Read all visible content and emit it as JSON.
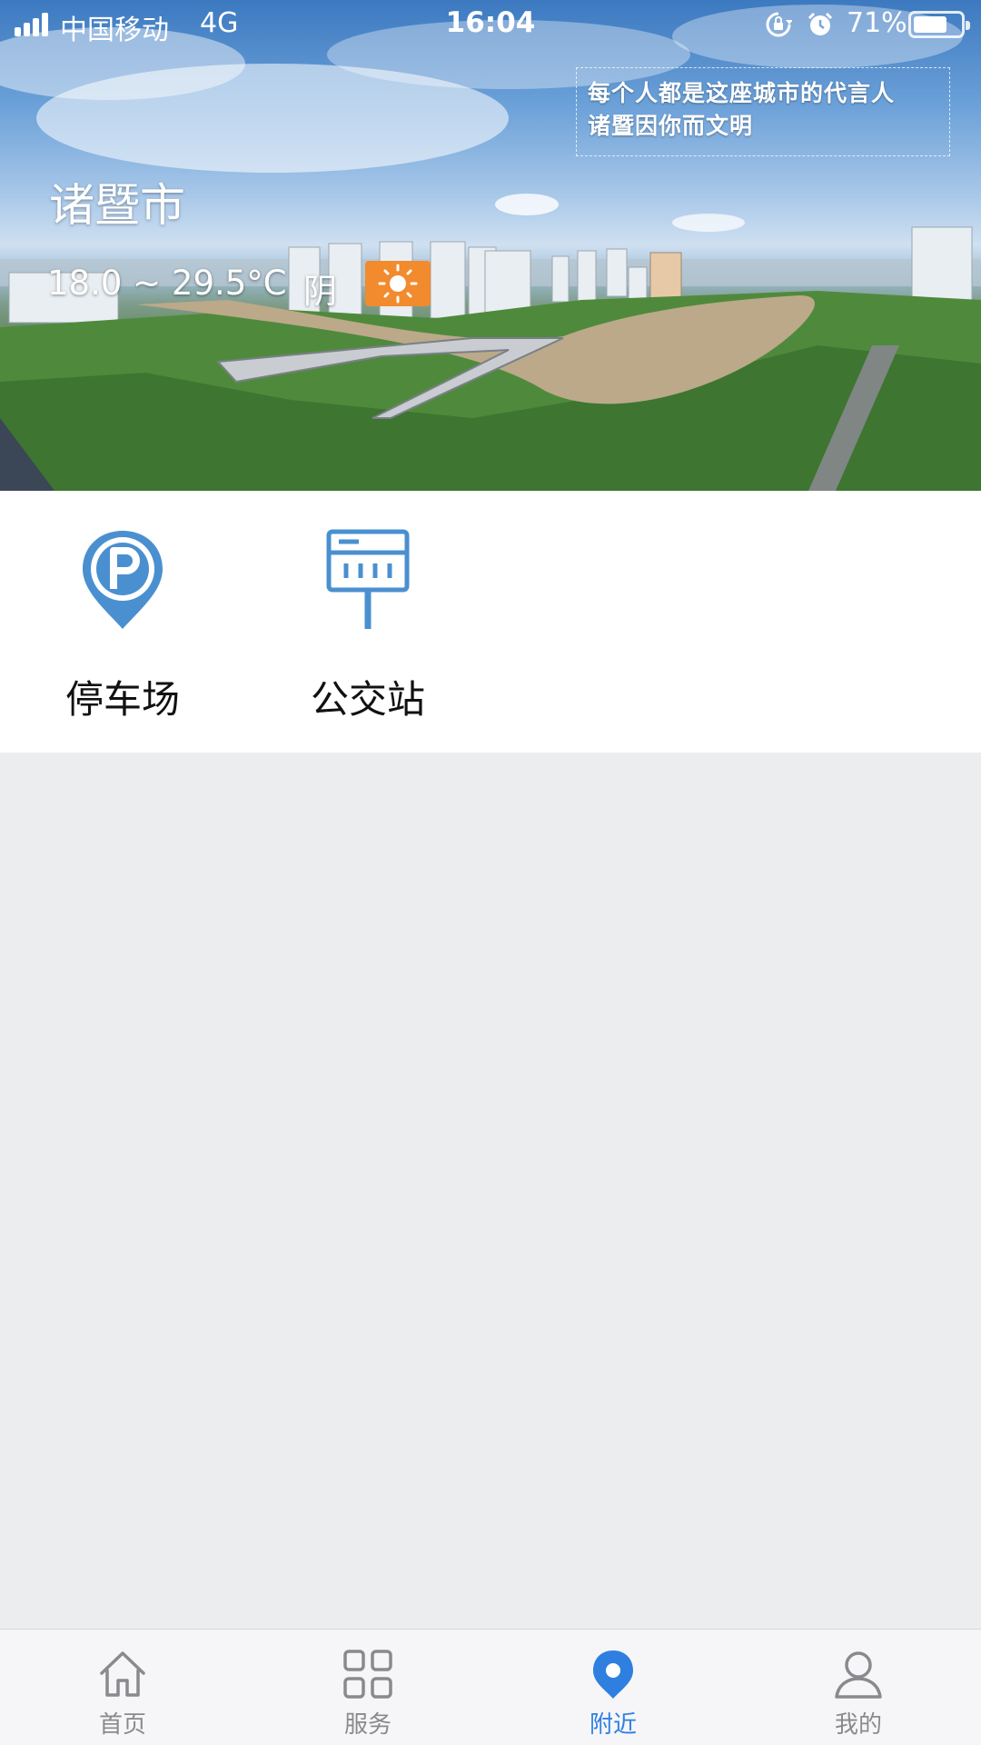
{
  "status_bar": {
    "carrier": "中国移动",
    "network": "4G",
    "time": "16:04",
    "battery_percent": "71%",
    "battery_level": 0.71,
    "icons": [
      "signal-icon",
      "rotation-lock-icon",
      "alarm-icon",
      "battery-icon"
    ]
  },
  "hero": {
    "slogan_line1": "每个人都是这座城市的代言人",
    "slogan_line2": "诸暨因你而文明",
    "city": "诸暨市",
    "temperature": "18.0 ~ 29.5°C",
    "condition": "阴",
    "weather_icon": "sun-icon",
    "weather_icon_color": "#F28A2E"
  },
  "services": [
    {
      "label": "停车场",
      "icon": "parking-pin-icon"
    },
    {
      "label": "公交站",
      "icon": "bus-stop-icon"
    }
  ],
  "tabbar": {
    "active_color": "#2E7FE0",
    "inactive_color": "#8a8a8e",
    "items": [
      {
        "label": "首页",
        "icon": "home-icon",
        "active": false
      },
      {
        "label": "服务",
        "icon": "grid-icon",
        "active": false
      },
      {
        "label": "附近",
        "icon": "location-pin-icon",
        "active": true
      },
      {
        "label": "我的",
        "icon": "user-icon",
        "active": false
      }
    ]
  },
  "colors": {
    "accent": "#4A90D0",
    "page_background": "#ECEDEF"
  }
}
